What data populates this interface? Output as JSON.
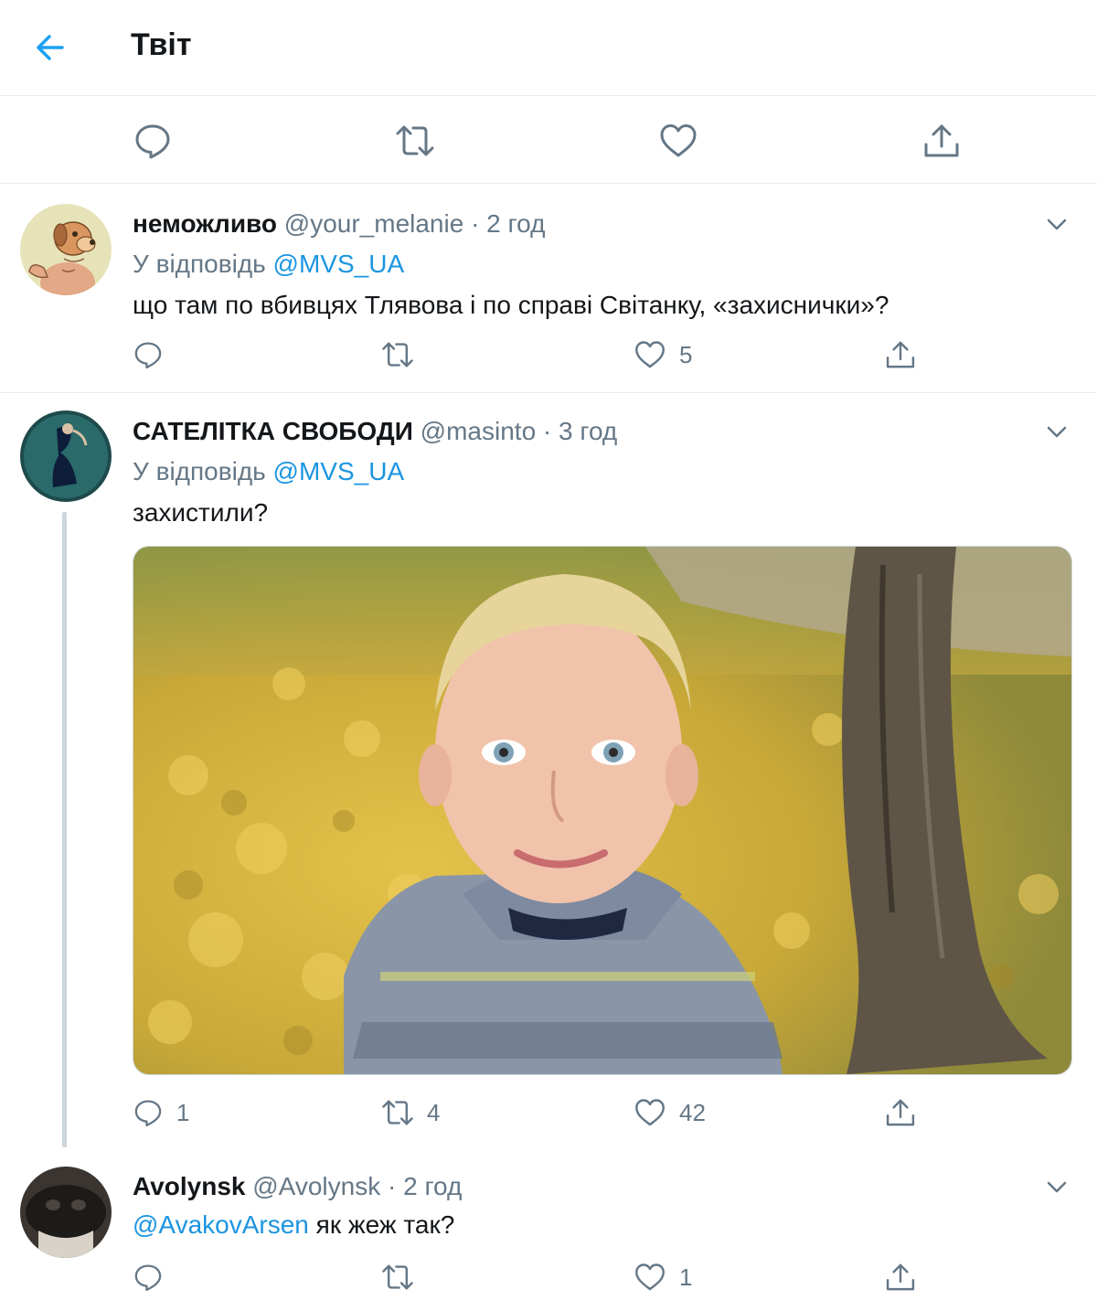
{
  "header": {
    "title": "Твіт",
    "back_icon": "arrow-left-icon",
    "accent": "#1da1f2"
  },
  "colors": {
    "link": "#1b95e0",
    "muted": "#657786",
    "text": "#14171a",
    "border": "#e6ecf0"
  },
  "tweets": [
    {
      "name": "неможливо",
      "meta": " @your_melanie · 2 год",
      "reply_prefix": "У відповідь ",
      "reply_mention": "@MVS_UA",
      "text": "що там по вбивцях Тлявова і по справі Світанку, «захиснички»?",
      "likes": "5"
    },
    {
      "name": "САТЕЛІТКА СВОБОДИ",
      "meta": " @masinto · 3 год",
      "reply_prefix": "У відповідь ",
      "reply_mention": "@MVS_UA",
      "text": "захистили?",
      "replies": "1",
      "retweets": "4",
      "likes": "42"
    },
    {
      "name": "Avolynsk",
      "meta": " @Avolynsk · 2 год",
      "mention": "@AvakovArsen",
      "text": " як жеж так?",
      "likes": "1"
    }
  ]
}
